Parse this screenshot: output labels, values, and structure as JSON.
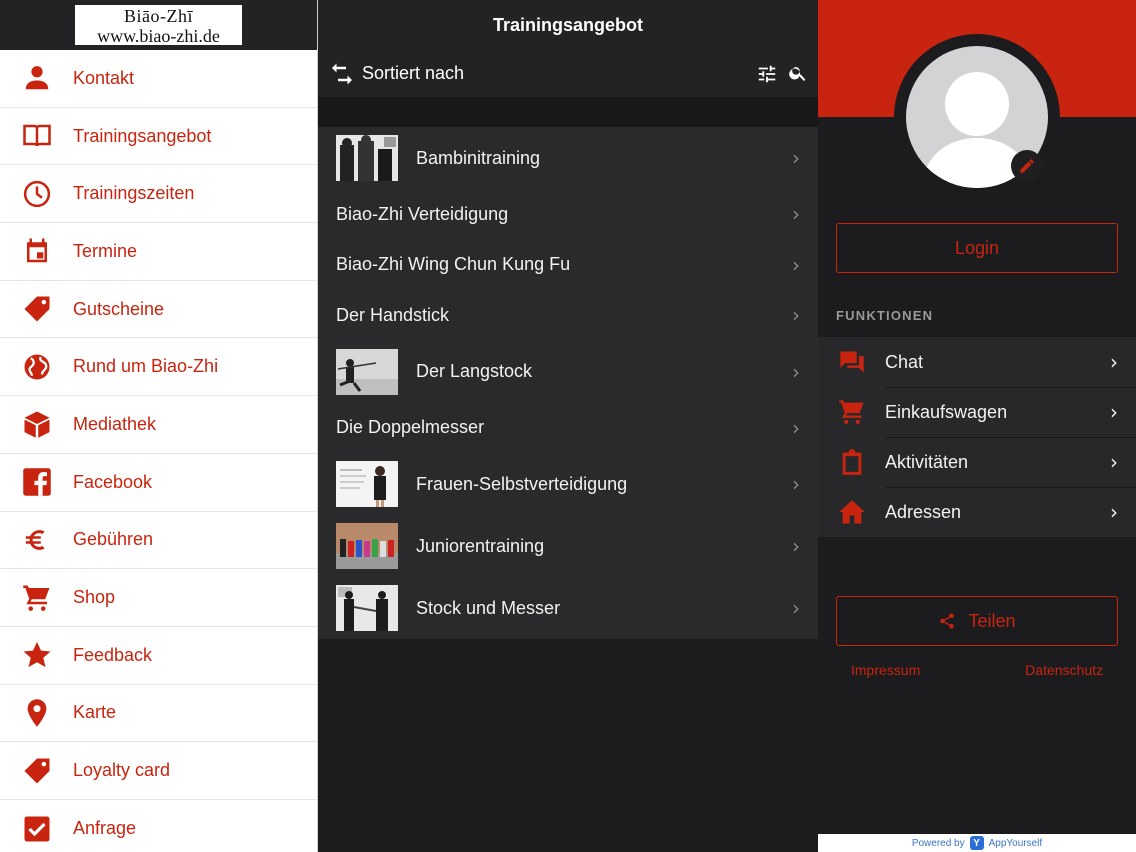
{
  "colors": {
    "accent": "#c8240f",
    "panel_dark": "#1c1c1e",
    "list_bg": "#2a2a2c"
  },
  "logo": {
    "line1": "Biāo-Zhī",
    "line2": "www.biao-zhi.de"
  },
  "sidebar": {
    "items": [
      {
        "label": "Kontakt",
        "icon": "person-icon"
      },
      {
        "label": "Trainingsangebot",
        "icon": "book-icon"
      },
      {
        "label": "Trainingszeiten",
        "icon": "clock-icon"
      },
      {
        "label": "Termine",
        "icon": "calendar-icon"
      },
      {
        "label": "Gutscheine",
        "icon": "tag-icon"
      },
      {
        "label": "Rund um Biao-Zhi",
        "icon": "globe-icon"
      },
      {
        "label": "Mediathek",
        "icon": "cube-icon"
      },
      {
        "label": "Facebook",
        "icon": "facebook-icon"
      },
      {
        "label": "Gebühren",
        "icon": "euro-icon"
      },
      {
        "label": "Shop",
        "icon": "cart-icon"
      },
      {
        "label": "Feedback",
        "icon": "star-icon"
      },
      {
        "label": "Karte",
        "icon": "map-pin-icon"
      },
      {
        "label": "Loyalty card",
        "icon": "tag-icon"
      },
      {
        "label": "Anfrage",
        "icon": "checkbox-icon"
      }
    ]
  },
  "middle": {
    "title": "Trainingsangebot",
    "sort_label": "Sortiert nach",
    "items": [
      {
        "label": "Bambinitraining",
        "has_image": true
      },
      {
        "label": "Biao-Zhi Verteidigung",
        "has_image": false
      },
      {
        "label": "Biao-Zhi Wing Chun Kung Fu",
        "has_image": false
      },
      {
        "label": "Der Handstick",
        "has_image": false
      },
      {
        "label": "Der Langstock",
        "has_image": true
      },
      {
        "label": "Die Doppelmesser",
        "has_image": false
      },
      {
        "label": "Frauen-Selbstverteidigung",
        "has_image": true
      },
      {
        "label": "Juniorentraining",
        "has_image": true
      },
      {
        "label": "Stock und Messer",
        "has_image": true
      }
    ]
  },
  "right": {
    "login_label": "Login",
    "functions_header": "FUNKTIONEN",
    "functions": [
      {
        "label": "Chat",
        "icon": "chat-icon"
      },
      {
        "label": "Einkaufswagen",
        "icon": "cart-icon"
      },
      {
        "label": "Aktivitäten",
        "icon": "clipboard-icon"
      },
      {
        "label": "Adressen",
        "icon": "home-icon"
      }
    ],
    "share_label": "Teilen",
    "impressum": "Impressum",
    "datenschutz": "Datenschutz",
    "powered_by": "Powered by",
    "powered_brand": "AppYourself"
  }
}
